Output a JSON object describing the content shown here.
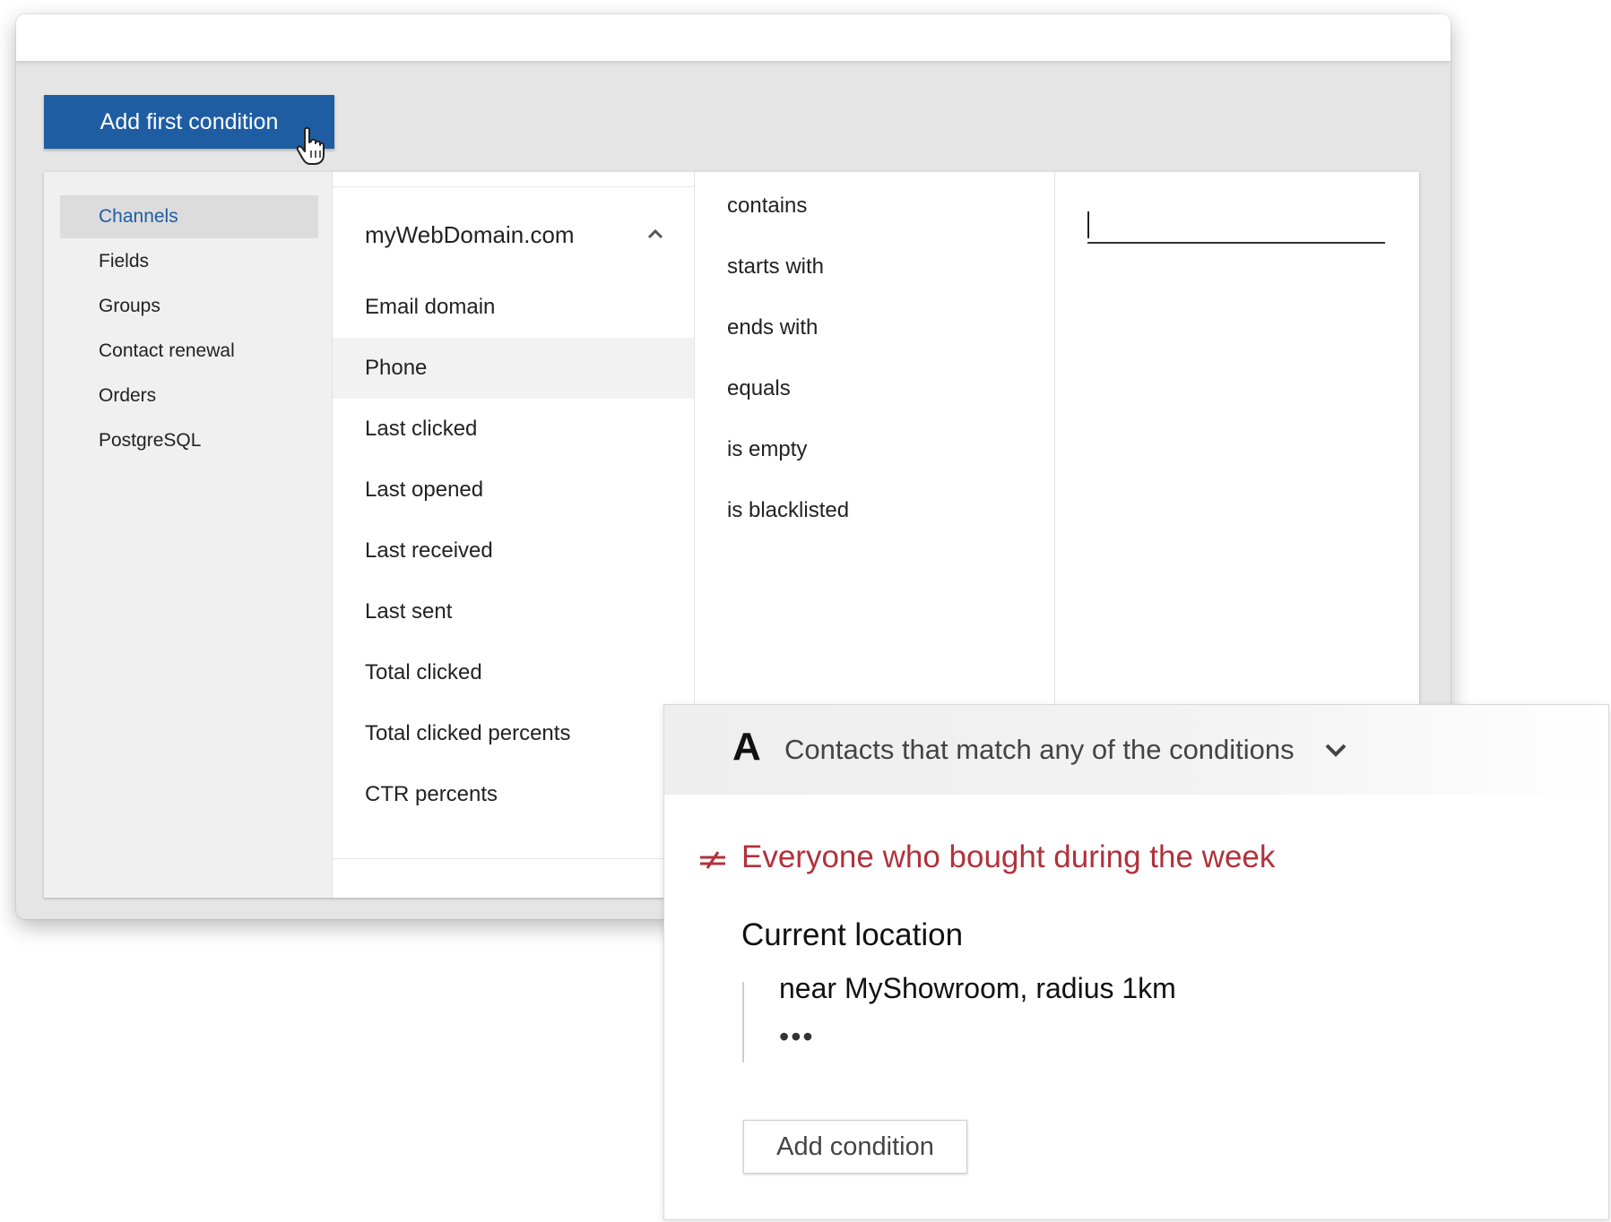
{
  "toolbar": {
    "add_first_condition_label": "Add first condition"
  },
  "categories": {
    "items": [
      {
        "label": "Channels",
        "selected": true
      },
      {
        "label": "Fields"
      },
      {
        "label": "Groups"
      },
      {
        "label": "Contact renewal"
      },
      {
        "label": "Orders"
      },
      {
        "label": "PostgreSQL"
      }
    ]
  },
  "fields": {
    "domain": "myWebDomain.com",
    "items": [
      {
        "label": "Email domain"
      },
      {
        "label": "Phone",
        "selected": true
      },
      {
        "label": "Last clicked"
      },
      {
        "label": "Last opened"
      },
      {
        "label": "Last received"
      },
      {
        "label": "Last sent"
      },
      {
        "label": "Total clicked"
      },
      {
        "label": "Total clicked percents"
      },
      {
        "label": "CTR percents"
      }
    ]
  },
  "operators": {
    "items": [
      {
        "label": "contains"
      },
      {
        "label": "starts with"
      },
      {
        "label": "ends with"
      },
      {
        "label": "equals"
      },
      {
        "label": "is empty"
      },
      {
        "label": "is blacklisted"
      }
    ]
  },
  "value_input": {
    "value": ""
  },
  "segment": {
    "group_letter": "A",
    "match_mode": "Contacts that match any of the conditions",
    "condition_title": "Everyone who bought during the week",
    "location_label": "Current location",
    "location_value": "near MyShowroom, radius 1km",
    "more": "•••",
    "add_condition_label": "Add condition"
  },
  "colors": {
    "primary": "#1f5da3",
    "condition_title": "#b0323c",
    "selected_category_text": "#1f5da3"
  },
  "icons": [
    "hand-pointer-icon",
    "chevron-up-icon",
    "chevron-down-icon",
    "condition-icon"
  ]
}
